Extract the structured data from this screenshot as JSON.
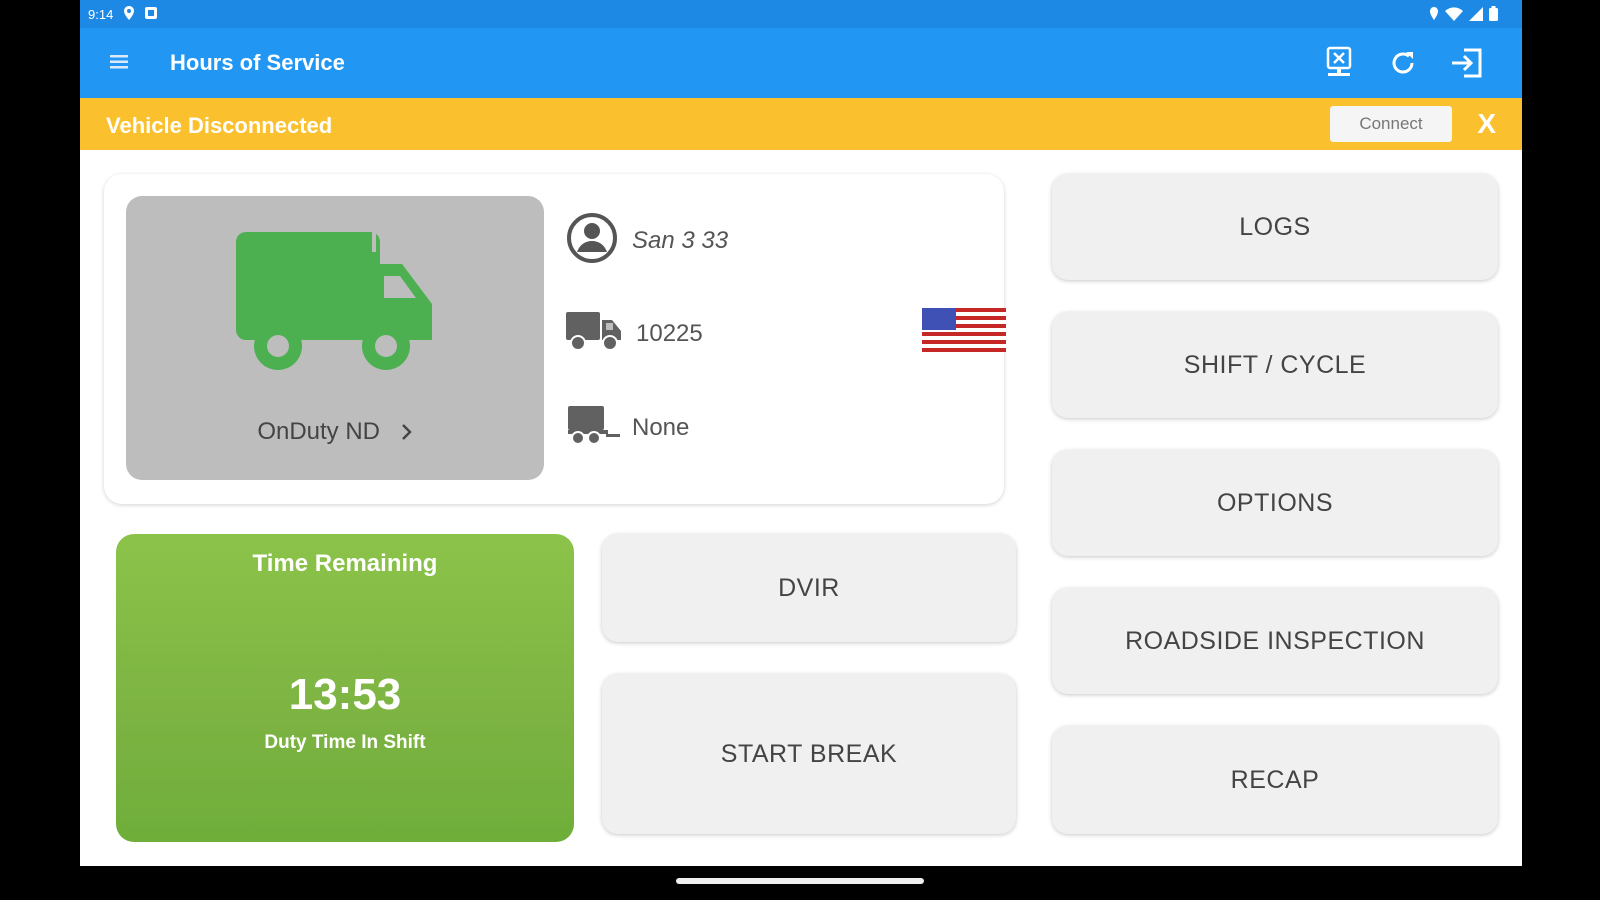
{
  "status_bar": {
    "time": "9:14"
  },
  "app_bar": {
    "title": "Hours of Service"
  },
  "banner": {
    "message": "Vehicle Disconnected",
    "connect_label": "Connect",
    "close_label": "X"
  },
  "driver_card": {
    "status_label": "OnDuty ND",
    "driver_name": "San 3 33",
    "vehicle_id": "10225",
    "trailer": "None"
  },
  "time_tile": {
    "title": "Time Remaining",
    "value": "13:53",
    "subtitle": "Duty Time In Shift"
  },
  "buttons": {
    "dvir": "DVIR",
    "start_break": "START BREAK",
    "logs": "LOGS",
    "shift_cycle": "SHIFT / CYCLE",
    "options": "OPTIONS",
    "roadside": "ROADSIDE INSPECTION",
    "recap": "RECAP"
  },
  "colors": {
    "app_bar": "#2196f3",
    "banner": "#fbc02d",
    "status_green": "#4caf50",
    "time_green": "#7cb342"
  }
}
